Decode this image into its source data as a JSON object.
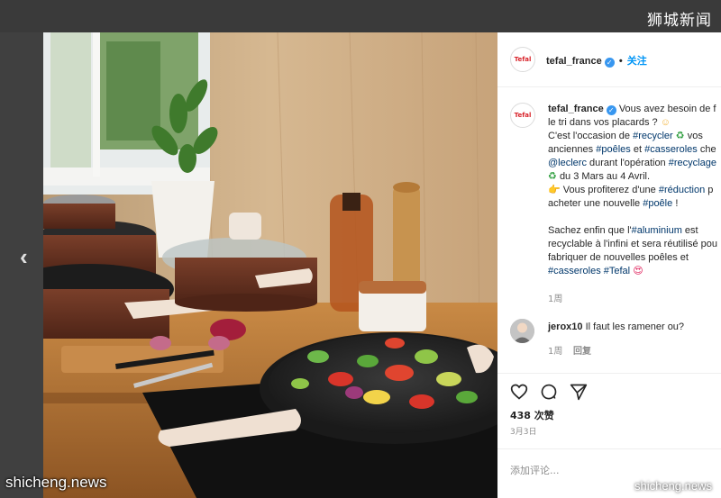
{
  "watermarks": {
    "top_right": "狮城新闻",
    "bottom_left": "shicheng.news",
    "bottom_right": "shicheng.news"
  },
  "navigation": {
    "prev_icon": "chevron-left-icon",
    "prev_glyph": "‹"
  },
  "post": {
    "header": {
      "avatar_text": "Tefal",
      "username": "tefal_france",
      "verified": "✓",
      "separator": "•",
      "follow_label": "关注"
    },
    "caption": {
      "avatar_text": "Tefal",
      "username": "tefal_france",
      "lines": [
        "Vous avez besoin de f",
        "le tri dans vos placards ?",
        "C'est l'occasion de",
        "anciennes",
        "durant l'opération",
        "du 3 Mars au 4 Avril.",
        "Vous profiterez d'une",
        "acheter une nouvelle",
        "Sachez enfin que l'",
        "recyclable à l'infini et sera réutilisé pou",
        "fabriquer de nouvelles poêles et"
      ],
      "tags": {
        "recycler": "#recycler",
        "poeles": "#poêles",
        "et": "et",
        "casseroles": "#casseroles",
        "chez": "che",
        "leclerc": "@leclerc",
        "recyclage": "#recyclage",
        "reduction": "#réduction",
        "reduction_tail": "p",
        "poele": "#poêle",
        "poele_tail": "!",
        "aluminium": "#aluminium",
        "aluminium_tail": "est",
        "casseroles2": "#casseroles",
        "tefal": "#Tefal",
        "vos": "vos"
      },
      "emoji": {
        "face": "☺",
        "recycle": "♻",
        "hand": "👉",
        "heart_eyes": "😍"
      },
      "time": "1周"
    },
    "comment": {
      "username": "jerox10",
      "text": "Il faut les ramener ou?",
      "time": "1周",
      "reply_label": "回复"
    },
    "actions": {
      "like_icon": "heart-icon",
      "comment_icon": "comment-icon",
      "share_icon": "share-icon",
      "likes": "438 次赞",
      "date": "3月3日"
    },
    "comment_box": {
      "placeholder": "添加评论..."
    }
  }
}
